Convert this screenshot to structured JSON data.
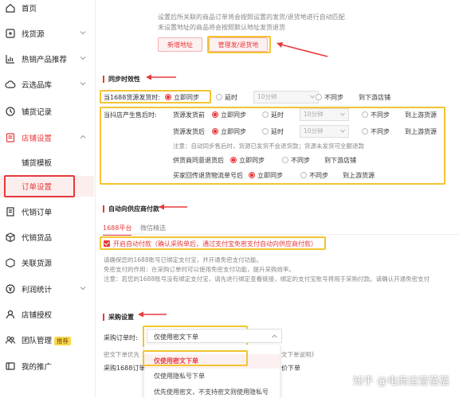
{
  "sidebar": {
    "items": [
      {
        "label": "首页",
        "icon": "home-icon"
      },
      {
        "label": "找货源",
        "icon": "search-goods-icon"
      },
      {
        "label": "热销产品推荐",
        "icon": "chart-icon"
      },
      {
        "label": "云选品库",
        "icon": "cloud-icon"
      },
      {
        "label": "铺货记录",
        "icon": "clock-icon"
      },
      {
        "label": "店铺设置",
        "icon": "shop-settings-icon"
      },
      {
        "label": "铺货模板"
      },
      {
        "label": "订单设置"
      },
      {
        "label": "代销订单",
        "icon": "order-icon"
      },
      {
        "label": "代销货品",
        "icon": "box-icon"
      },
      {
        "label": "关联货源",
        "icon": "link-icon"
      },
      {
        "label": "利润统计",
        "icon": "profit-icon"
      },
      {
        "label": "店铺授权",
        "icon": "authorize-icon"
      },
      {
        "label": "团队管理",
        "icon": "team-icon",
        "badge": "推荐"
      },
      {
        "label": "我的推广",
        "icon": "promo-icon"
      }
    ]
  },
  "address": {
    "note1": "设置后所关联的商品订单将会按照设置的发货/退货地进行自动匹配",
    "note2": "未设置地址的商品将会按照默认地址发货退货",
    "add_button": "新增地址",
    "manage_button": "管理发/退货地"
  },
  "sync": {
    "title": "同步时效性",
    "row1": {
      "label": "当1688货源发货时:",
      "opt_now": "立即同步",
      "opt_delay": "延时",
      "delay_value": "10分钟",
      "opt_none": "不同步",
      "opt_manual": "到下游店铺"
    },
    "row2_label": "当抖店产生售后时:",
    "row2a": {
      "label": "货源发货前",
      "opt_now": "立即同步",
      "opt_delay": "延时",
      "delay_value": "10分钟",
      "opt_none": "不同步",
      "opt_manual": "到上游货源"
    },
    "row2b": {
      "label": "货源发货后",
      "opt_now": "立即同步",
      "opt_delay": "延时",
      "delay_value": "10分钟",
      "opt_none": "不同步",
      "opt_manual": "到上游货源"
    },
    "row2_note": "注意：自动同步售后时，货源已发货不会退货款；货源未发货可全额退款",
    "row3": {
      "label": "供货商同意退货后",
      "opt_now": "立即同步",
      "opt_none": "不同步",
      "opt_manual": "到下游店铺"
    },
    "row4": {
      "label": "买家回传退货物流单号后",
      "opt_now": "立即同步",
      "opt_none": "不同步",
      "opt_manual": "到上游货源"
    }
  },
  "autopay": {
    "title": "自动向供应商付款",
    "tab1": "1688平台",
    "tab2": "微信精选",
    "checkbox_label": "开启自动付款（确认采购单后，通过支付宝免密支付自动向供应商付款）",
    "note1": "请确保您的1688账号已绑定支付宝，并开通免密支付功能。",
    "note2": "免密支付的作用：在采购订单时可以使用免密支付功能，提升采购效率。",
    "note3": "注意：若您的1688账号没有绑定支付宝，请先进行绑定查看链接，绑定的支付宝账号将用于采购付款。请确认开通免密支付"
  },
  "purchase": {
    "title": "采购设置",
    "order_label": "采购订单时:",
    "selected": "仅使用密文下单",
    "line1": "密文下单优先",
    "line1b": "文下单说明》",
    "line2": "采购1688订单",
    "line2b": "价下单",
    "options": [
      "仅使用密文下单",
      "仅使用隐私号下单",
      "优先使用密文，不支持密文则使用隐私号"
    ]
  },
  "watermark": "知乎 @电商运营蓓蓓",
  "colors": {
    "accent": "#e6393a",
    "highlight": "#f4c431"
  }
}
